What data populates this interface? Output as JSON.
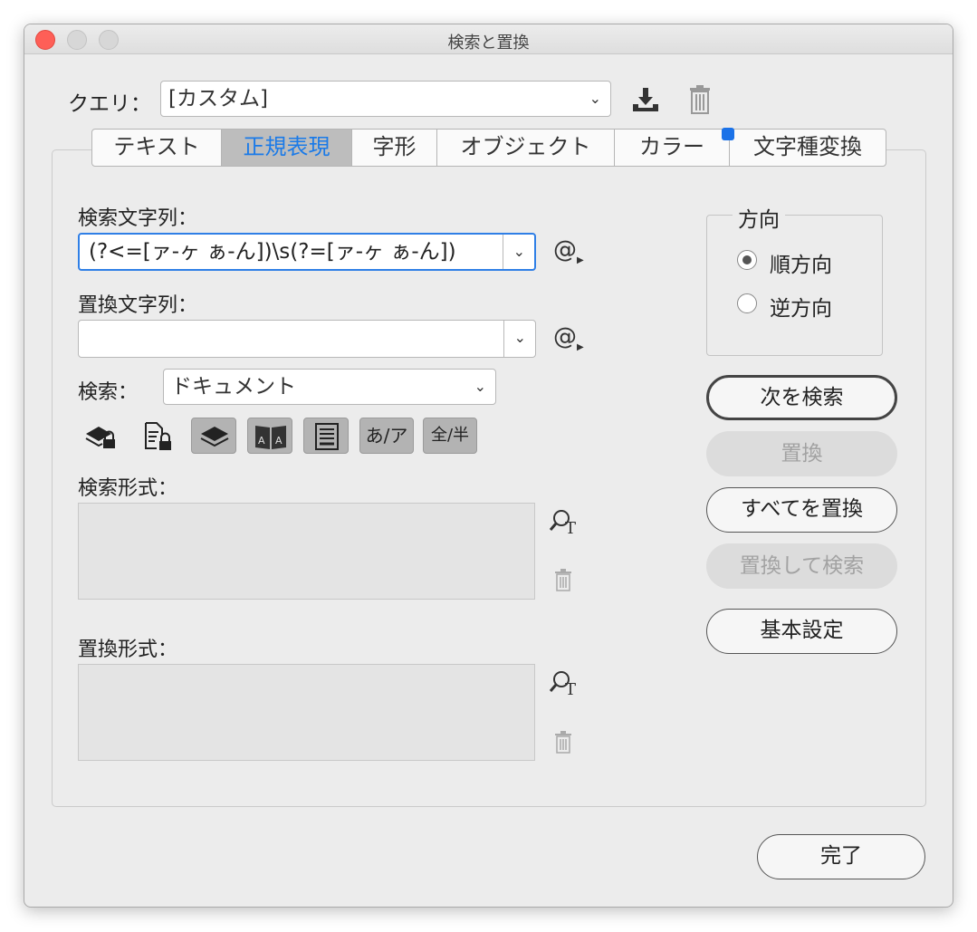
{
  "window": {
    "title": "検索と置換"
  },
  "query": {
    "label": "クエリ：",
    "value": "[カスタム]"
  },
  "tabs": [
    {
      "label": "テキスト",
      "active": false
    },
    {
      "label": "正規表現",
      "active": true
    },
    {
      "label": "字形",
      "active": false
    },
    {
      "label": "オブジェクト",
      "active": false
    },
    {
      "label": "カラー",
      "active": false
    },
    {
      "label": "文字種変換",
      "active": false
    }
  ],
  "find": {
    "label": "検索文字列：",
    "value": "(?<=[ァ-ヶ ぁ-ん])\\s(?=[ァ-ヶ ぁ-ん])",
    "special_char_icon": "@"
  },
  "change": {
    "label": "置換文字列：",
    "value": "",
    "special_char_icon": "@"
  },
  "search": {
    "label": "検索：",
    "value": "ドキュメント"
  },
  "options": [
    {
      "icon": "include-locked-layers-icon",
      "on": false
    },
    {
      "icon": "include-locked-stories-icon",
      "on": false
    },
    {
      "icon": "include-hidden-layers-icon",
      "on": true
    },
    {
      "icon": "include-master-pages-icon",
      "on": true
    },
    {
      "icon": "include-footnotes-icon",
      "on": true
    },
    {
      "icon": "kana-sensitive-icon",
      "label": "あ/ア",
      "on": true
    },
    {
      "icon": "width-sensitive-icon",
      "label": "全/半",
      "on": true
    }
  ],
  "find_format": {
    "label": "検索形式："
  },
  "change_format": {
    "label": "置換形式："
  },
  "direction": {
    "legend": "方向",
    "options": [
      {
        "label": "順方向",
        "selected": true
      },
      {
        "label": "逆方向",
        "selected": false
      }
    ]
  },
  "buttons": {
    "find_next": "次を検索",
    "change": "置換",
    "change_all": "すべてを置換",
    "change_find": "置換して検索",
    "fewer_options": "基本設定",
    "done": "完了"
  },
  "colors": {
    "accent": "#1a7ae8",
    "close": "#fe5f57",
    "badge": "#1b72e8"
  }
}
